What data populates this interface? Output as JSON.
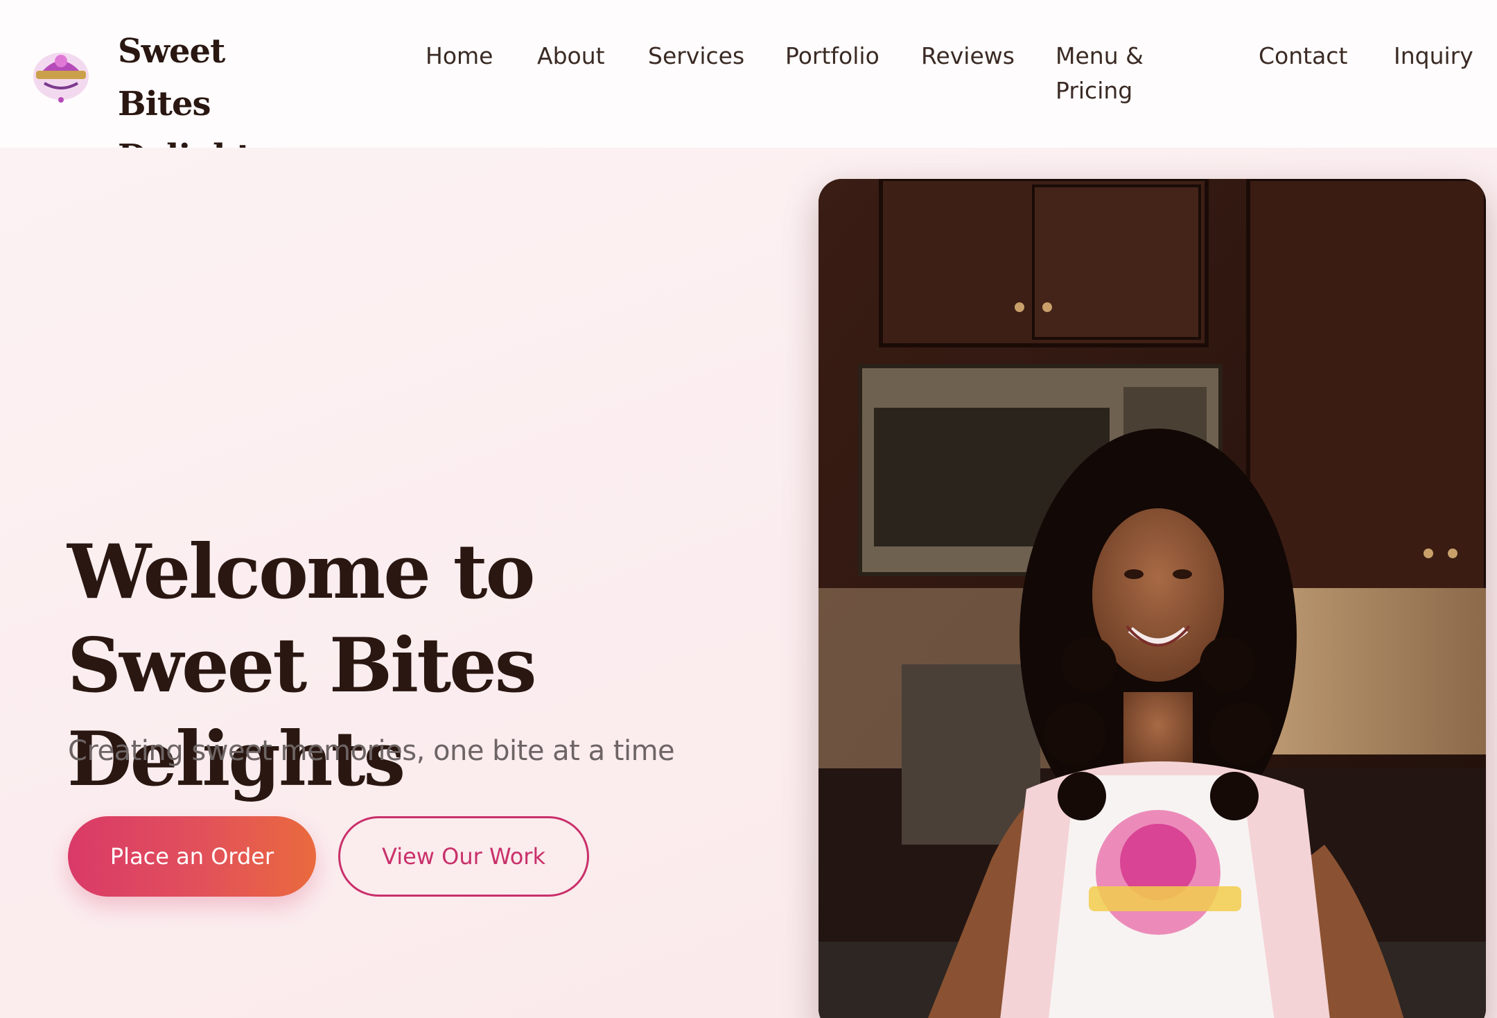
{
  "header": {
    "brand_name": "Sweet Bites Delights",
    "nav": [
      {
        "label": "Home"
      },
      {
        "label": "About"
      },
      {
        "label": "Services"
      },
      {
        "label": "Portfolio"
      },
      {
        "label": "Reviews"
      },
      {
        "label": "Menu & Pricing"
      },
      {
        "label": "Contact"
      },
      {
        "label": "Inquiry"
      }
    ]
  },
  "hero": {
    "title": "Welcome to Sweet Bites Delights",
    "subtitle": "Creating sweet memories, one bite at a time",
    "primary_button": "Place an Order",
    "secondary_button": "View Our Work"
  },
  "colors": {
    "brand_dark": "#2a1711",
    "accent_pink": "#c9306a",
    "gradient_start": "#d93a68",
    "gradient_end": "#ea6a3d",
    "hero_background": "#fbeef0"
  }
}
